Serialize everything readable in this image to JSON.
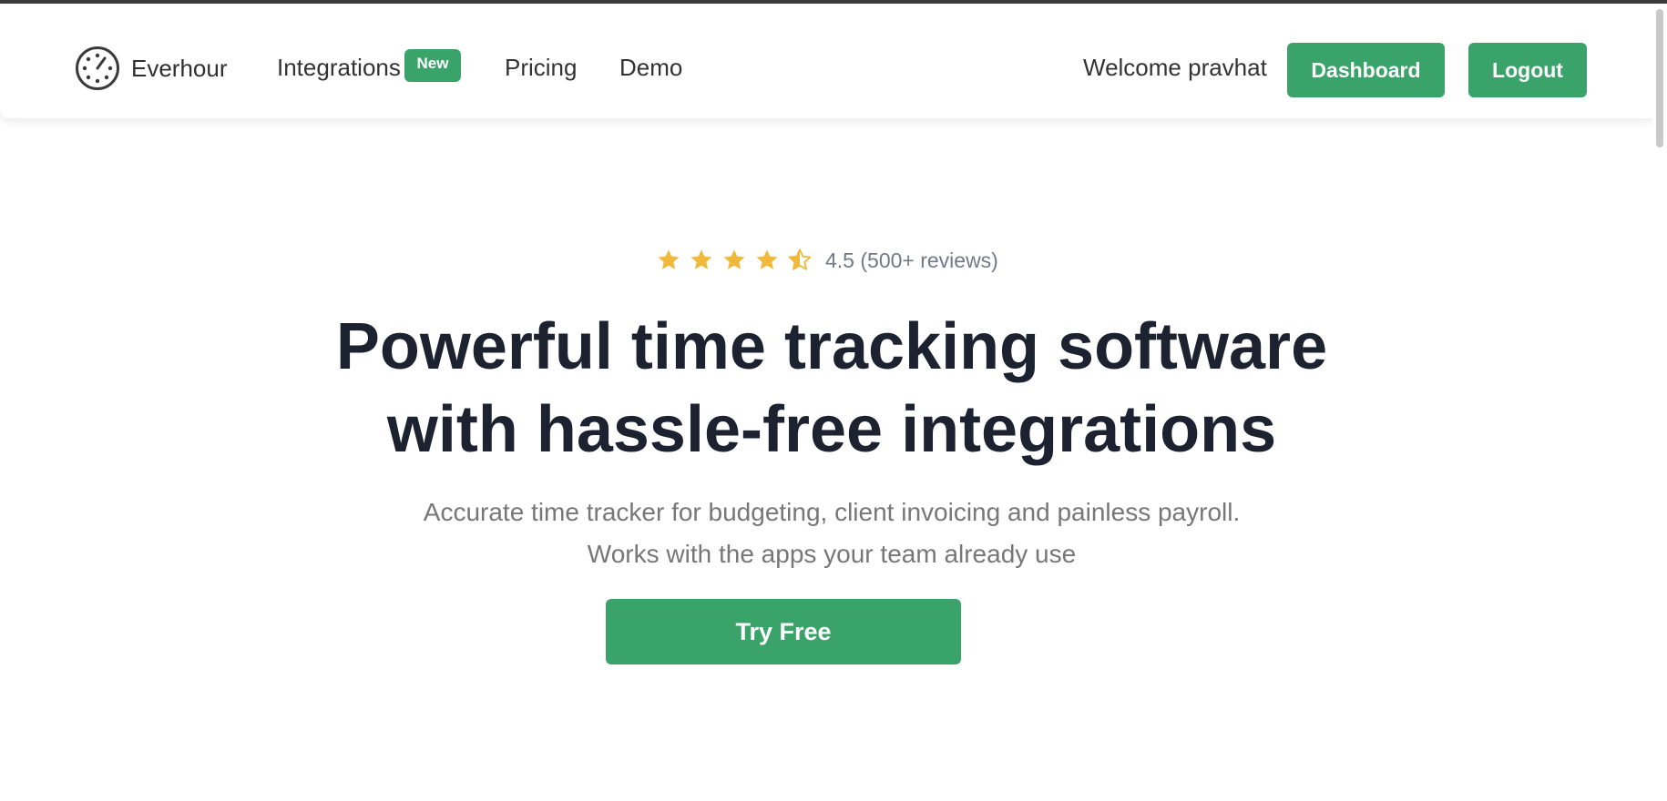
{
  "brand": {
    "name": "Everhour",
    "logo_icon": "stopwatch-dial-icon"
  },
  "nav": {
    "links": [
      {
        "label": "Integrations"
      },
      {
        "label": "Pricing"
      },
      {
        "label": "Demo"
      }
    ],
    "integrations_badge": "New",
    "welcome_text": "Welcome pravhat",
    "dashboard_label": "Dashboard",
    "logout_label": "Logout"
  },
  "hero": {
    "rating": {
      "value": 4.5,
      "max": 5,
      "text": "4.5 (500+ reviews)",
      "star_icon": "star-icon",
      "star_color": "#f0b93a"
    },
    "headline_line1": "Powerful time tracking software",
    "headline_line2": "with hassle-free integrations",
    "sub_line1": "Accurate time tracker for budgeting, client invoicing and painless payroll.",
    "sub_line2": "Works with the apps your team already use",
    "cta_label": "Try Free"
  },
  "colors": {
    "accent": "#39a36a",
    "headline": "#1d2230",
    "body_text": "#777777",
    "rating_text": "#707a86"
  }
}
